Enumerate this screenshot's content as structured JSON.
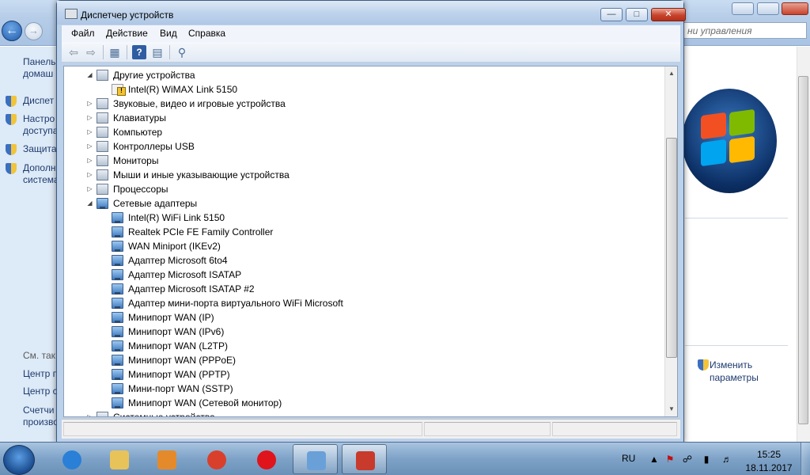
{
  "background_window": {
    "search_placeholder": "ни управления",
    "left_links": [
      {
        "text": "Панель",
        "muted": false
      },
      {
        "text": "домаш",
        "muted": false
      },
      {
        "text": "Диспет",
        "muted": false,
        "shield": true
      },
      {
        "text": "Настро",
        "muted": false,
        "shield": true
      },
      {
        "text": "доступа",
        "muted": false
      },
      {
        "text": "Защита",
        "muted": false,
        "shield": true
      },
      {
        "text": "Дополн",
        "muted": false,
        "shield": true
      },
      {
        "text": "система",
        "muted": false
      },
      {
        "text": "См. так",
        "muted": true
      },
      {
        "text": "Центр п",
        "muted": false
      },
      {
        "text": "Центр с",
        "muted": false
      },
      {
        "text": "Счетчи",
        "muted": false
      },
      {
        "text": "произво",
        "muted": false
      }
    ],
    "change_params": [
      "Изменить",
      "параметры"
    ]
  },
  "device_manager": {
    "title": "Диспетчер устройств",
    "menu": [
      "Файл",
      "Действие",
      "Вид",
      "Справка"
    ],
    "toolbar_icons": [
      "back-icon",
      "forward-icon",
      "show-hide-console-tree-icon",
      "help-icon",
      "properties-icon",
      "scan-hardware-icon"
    ],
    "tree": [
      {
        "label": "Другие устройства",
        "level": 0,
        "expanded": true,
        "icon": "other-devices-icon"
      },
      {
        "label": "Intel(R) WiMAX Link 5150",
        "level": 1,
        "icon": "unknown-device-warning-icon"
      },
      {
        "label": "Звуковые, видео и игровые устройства",
        "level": 0,
        "expanded": false,
        "icon": "speaker-icon"
      },
      {
        "label": "Клавиатуры",
        "level": 0,
        "expanded": false,
        "icon": "keyboard-icon"
      },
      {
        "label": "Компьютер",
        "level": 0,
        "expanded": false,
        "icon": "computer-icon"
      },
      {
        "label": "Контроллеры USB",
        "level": 0,
        "expanded": false,
        "icon": "usb-icon"
      },
      {
        "label": "Мониторы",
        "level": 0,
        "expanded": false,
        "icon": "monitor-icon"
      },
      {
        "label": "Мыши и иные указывающие устройства",
        "level": 0,
        "expanded": false,
        "icon": "mouse-icon"
      },
      {
        "label": "Процессоры",
        "level": 0,
        "expanded": false,
        "icon": "processor-icon"
      },
      {
        "label": "Сетевые адаптеры",
        "level": 0,
        "expanded": true,
        "icon": "network-adapter-icon"
      },
      {
        "label": "Intel(R) WiFi Link 5150",
        "level": 1,
        "icon": "network-adapter-icon"
      },
      {
        "label": "Realtek PCIe FE Family Controller",
        "level": 1,
        "icon": "network-adapter-icon"
      },
      {
        "label": "WAN Miniport (IKEv2)",
        "level": 1,
        "icon": "network-adapter-icon"
      },
      {
        "label": "Адаптер Microsoft 6to4",
        "level": 1,
        "icon": "network-adapter-icon"
      },
      {
        "label": "Адаптер Microsoft ISATAP",
        "level": 1,
        "icon": "network-adapter-icon"
      },
      {
        "label": "Адаптер Microsoft ISATAP #2",
        "level": 1,
        "icon": "network-adapter-icon"
      },
      {
        "label": "Адаптер мини-порта виртуального WiFi Microsoft",
        "level": 1,
        "icon": "network-adapter-icon"
      },
      {
        "label": "Минипорт WAN (IP)",
        "level": 1,
        "icon": "network-adapter-icon"
      },
      {
        "label": "Минипорт WAN (IPv6)",
        "level": 1,
        "icon": "network-adapter-icon"
      },
      {
        "label": "Минипорт WAN (L2TP)",
        "level": 1,
        "icon": "network-adapter-icon"
      },
      {
        "label": "Минипорт WAN (PPPoE)",
        "level": 1,
        "icon": "network-adapter-icon"
      },
      {
        "label": "Минипорт WAN (PPTP)",
        "level": 1,
        "icon": "network-adapter-icon"
      },
      {
        "label": "Мини-порт WAN (SSTP)",
        "level": 1,
        "icon": "network-adapter-icon"
      },
      {
        "label": "Минипорт WAN (Сетевой монитор)",
        "level": 1,
        "icon": "network-adapter-icon"
      },
      {
        "label": "Системные устройства",
        "level": 0,
        "expanded": false,
        "icon": "system-devices-icon"
      }
    ]
  },
  "taskbar": {
    "apps": [
      {
        "name": "ie-icon",
        "color": "#2a7fd6",
        "active": false
      },
      {
        "name": "explorer-icon",
        "color": "#e8c35a",
        "active": false
      },
      {
        "name": "media-player-icon",
        "color": "#e58a2a",
        "active": false
      },
      {
        "name": "chrome-icon",
        "color": "#d8402c",
        "active": false
      },
      {
        "name": "opera-icon",
        "color": "#e0141b",
        "active": false
      },
      {
        "name": "control-panel-icon",
        "color": "#6aa0d8",
        "active": true
      },
      {
        "name": "device-manager-icon",
        "color": "#c83a2c",
        "active": true
      }
    ],
    "language": "RU",
    "time": "15:25",
    "date": "18.11.2017"
  }
}
